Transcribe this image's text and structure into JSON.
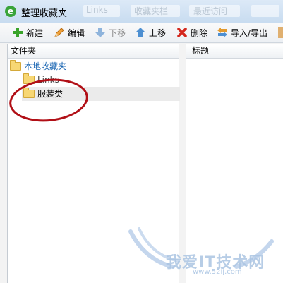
{
  "window": {
    "title": "整理收藏夹",
    "ghost_texts": [
      "Links",
      "收藏夹栏",
      "最近访问"
    ]
  },
  "toolbar": {
    "new_label": "新建",
    "edit_label": "编辑",
    "move_down_label": "下移",
    "move_up_label": "上移",
    "delete_label": "删除",
    "import_export_label": "导入/导出"
  },
  "folders_pane": {
    "header": "文件夹",
    "items": [
      {
        "label": "本地收藏夹",
        "selected": false
      },
      {
        "label": "Links",
        "selected": false
      },
      {
        "label": "服装类",
        "selected": true
      }
    ]
  },
  "bookmarks_pane": {
    "header": "标题"
  },
  "watermark": {
    "title": "我爱IT技术网",
    "url": "www.52ij.com"
  },
  "colors": {
    "annotation": "#b10f16",
    "tree_root_text": "#1a66b3",
    "selection_bg": "#ebebeb"
  }
}
